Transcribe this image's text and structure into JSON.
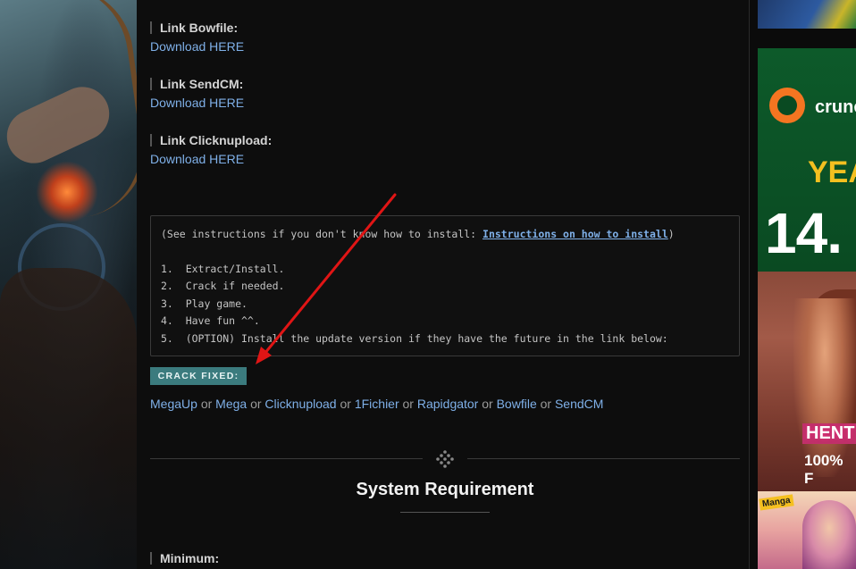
{
  "downloads": [
    {
      "label": "Link Bowfile:",
      "link_text": "Download HERE"
    },
    {
      "label": "Link SendCM:",
      "link_text": "Download HERE"
    },
    {
      "label": "Link Clicknupload:",
      "link_text": "Download HERE"
    }
  ],
  "instructions": {
    "intro_prefix": "(See instructions if you don't know how to install: ",
    "intro_link": "Instructions on how to install",
    "intro_suffix": ")",
    "steps": [
      "1.  Extract/Install.",
      "2.  Crack if needed.",
      "3.  Play game.",
      "4.  Have fun ^^.",
      "5.  (OPTION) Install the update version if they have the future in the link below:"
    ]
  },
  "crack_badge": "CRACK FIXED:",
  "mirrors": {
    "links": [
      "MegaUp",
      "Mega",
      "Clicknupload",
      "1Fichier",
      "Rapidgator",
      "Bowfile",
      "SendCM"
    ],
    "separator": "or"
  },
  "system": {
    "title": "System Requirement",
    "minimum_label": "Minimum:"
  },
  "ads": {
    "crunchyroll_name": "crunc",
    "crunchyroll_year": "YEA",
    "crunchyroll_price": "14.",
    "hentai_title": "HENT",
    "hentai_sub": "100% F",
    "manga_logo": "Manga"
  },
  "colors": {
    "link": "#7fb0e8",
    "badge": "#3b7b7e",
    "arrow": "#e01515"
  }
}
